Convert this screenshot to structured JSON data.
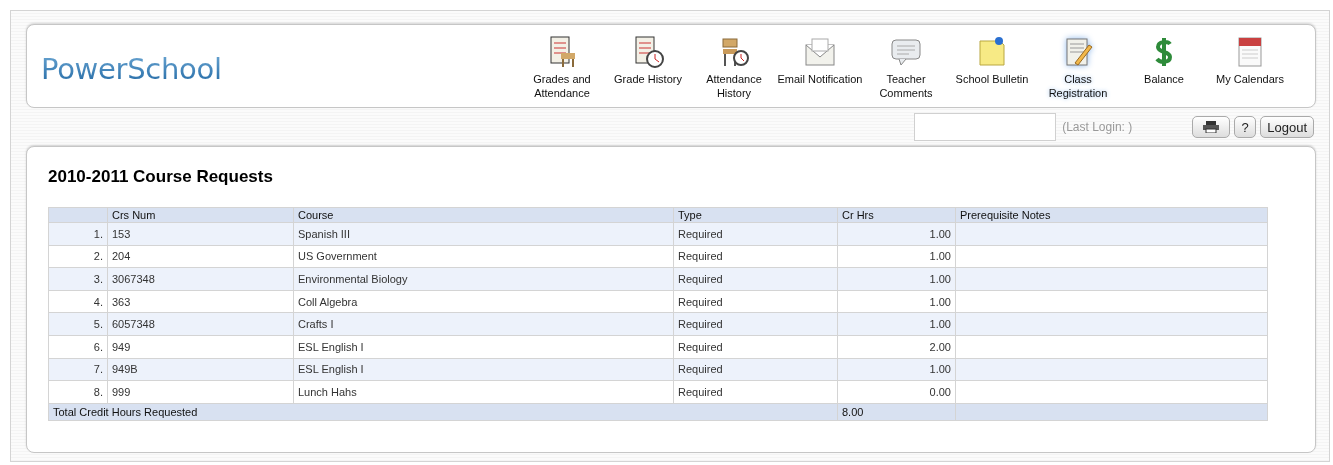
{
  "logo": "PowerSchool",
  "nav": [
    {
      "label": "Grades and Attendance",
      "selected": false
    },
    {
      "label": "Grade History",
      "selected": false
    },
    {
      "label": "Attendance History",
      "selected": false
    },
    {
      "label": "Email Notification",
      "selected": false
    },
    {
      "label": "Teacher Comments",
      "selected": false
    },
    {
      "label": "School Bulletin",
      "selected": false
    },
    {
      "label": "Class Registration",
      "selected": true
    },
    {
      "label": "Balance",
      "selected": false
    },
    {
      "label": "My Calendars",
      "selected": false
    }
  ],
  "last_login": "(Last Login: )",
  "help_button": "?",
  "logout_button": "Logout",
  "title": "2010-2011 Course Requests",
  "table": {
    "columns": [
      "Crs Num",
      "Course",
      "Type",
      "Cr Hrs",
      "Prerequisite Notes"
    ],
    "rows": [
      {
        "index": "1.",
        "crs_num": "153",
        "course": "Spanish III",
        "type": "Required",
        "cr_hrs": "1.00"
      },
      {
        "index": "2.",
        "crs_num": "204",
        "course": "US Government",
        "type": "Required",
        "cr_hrs": "1.00"
      },
      {
        "index": "3.",
        "crs_num": "3067348",
        "course": "Environmental Biology",
        "type": "Required",
        "cr_hrs": "1.00"
      },
      {
        "index": "4.",
        "crs_num": "363",
        "course": "Coll Algebra",
        "type": "Required",
        "cr_hrs": "1.00"
      },
      {
        "index": "5.",
        "crs_num": "6057348",
        "course": "Crafts I",
        "type": "Required",
        "cr_hrs": "1.00"
      },
      {
        "index": "6.",
        "crs_num": "949",
        "course": "ESL English I",
        "type": "Required",
        "cr_hrs": "2.00"
      },
      {
        "index": "7.",
        "crs_num": "949B",
        "course": "ESL English I",
        "type": "Required",
        "cr_hrs": "1.00"
      },
      {
        "index": "8.",
        "crs_num": "999",
        "course": "Lunch Hahs",
        "type": "Required",
        "cr_hrs": "0.00"
      }
    ],
    "total": {
      "label": "Total Credit Hours Requested",
      "cr_hrs": "8.00"
    }
  }
}
